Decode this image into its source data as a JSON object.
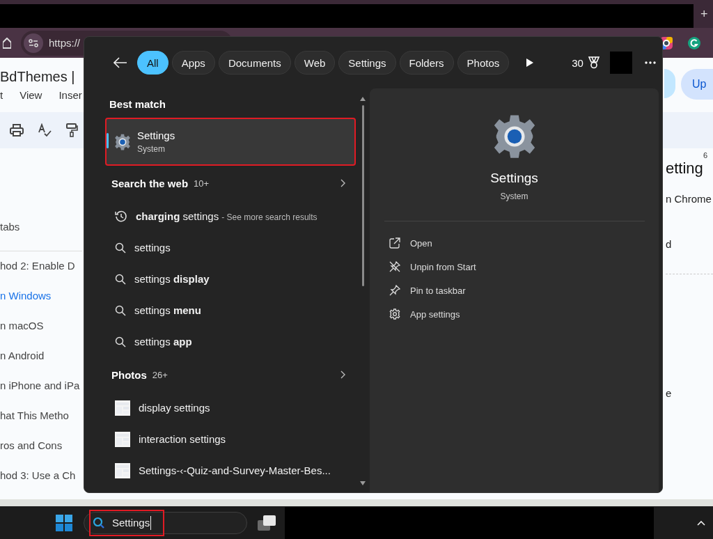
{
  "browser": {
    "address": "https://",
    "new_tab": "+"
  },
  "document": {
    "title": "BdThemes | ",
    "menu": [
      "t",
      "View",
      "Inser"
    ],
    "button": "Up",
    "ruler_mark": "6",
    "heading": "etting",
    "outline": [
      {
        "text": "tabs",
        "link": false
      },
      {
        "text": "hod 2: Enable D",
        "link": false
      },
      {
        "text": "n Windows",
        "link": true
      },
      {
        "text": "n macOS",
        "link": false
      },
      {
        "text": "n Android",
        "link": false
      },
      {
        "text": "n iPhone and iPa",
        "link": false
      },
      {
        "text": "hat This Metho",
        "link": false
      },
      {
        "text": "ros and Cons",
        "link": false
      },
      {
        "text": "hod 3: Use a Ch",
        "link": false
      }
    ],
    "body": [
      "n Chrome",
      "d",
      "e"
    ]
  },
  "search": {
    "filters": [
      {
        "label": "All",
        "selected": true
      },
      {
        "label": "Apps",
        "selected": false
      },
      {
        "label": "Documents",
        "selected": false
      },
      {
        "label": "Web",
        "selected": false
      },
      {
        "label": "Settings",
        "selected": false
      },
      {
        "label": "Folders",
        "selected": false
      },
      {
        "label": "Photos",
        "selected": false
      }
    ],
    "points": "30",
    "best_match": {
      "heading": "Best match",
      "title": "Settings",
      "subtitle": "System",
      "selected": true,
      "highlighted": true
    },
    "web": {
      "heading": "Search the web",
      "count": "10+",
      "results": [
        {
          "kind": "history",
          "text": "**charging** settings",
          "suffix": "- See more search results"
        },
        {
          "kind": "search",
          "text": "settings"
        },
        {
          "kind": "search",
          "text": "settings **display**"
        },
        {
          "kind": "search",
          "text": "settings **menu**"
        },
        {
          "kind": "search",
          "text": "settings **app**"
        }
      ]
    },
    "photos": {
      "heading": "Photos",
      "count": "26+",
      "items": [
        {
          "kind": "picture",
          "name": "display settings"
        },
        {
          "kind": "picture",
          "name": "interaction settings"
        },
        {
          "kind": "picture",
          "name": "Settings-‹-Quiz-and-Survey-Master-Bes..."
        }
      ]
    },
    "preview": {
      "title": "Settings",
      "subtitle": "System",
      "actions": [
        {
          "kind": "open",
          "label": "Open"
        },
        {
          "kind": "unpin",
          "label": "Unpin from Start"
        },
        {
          "kind": "pin",
          "label": "Pin to taskbar"
        },
        {
          "kind": "settings",
          "label": "App settings"
        }
      ]
    }
  },
  "taskbar": {
    "search": {
      "value": "Settings",
      "highlighted": true
    }
  }
}
